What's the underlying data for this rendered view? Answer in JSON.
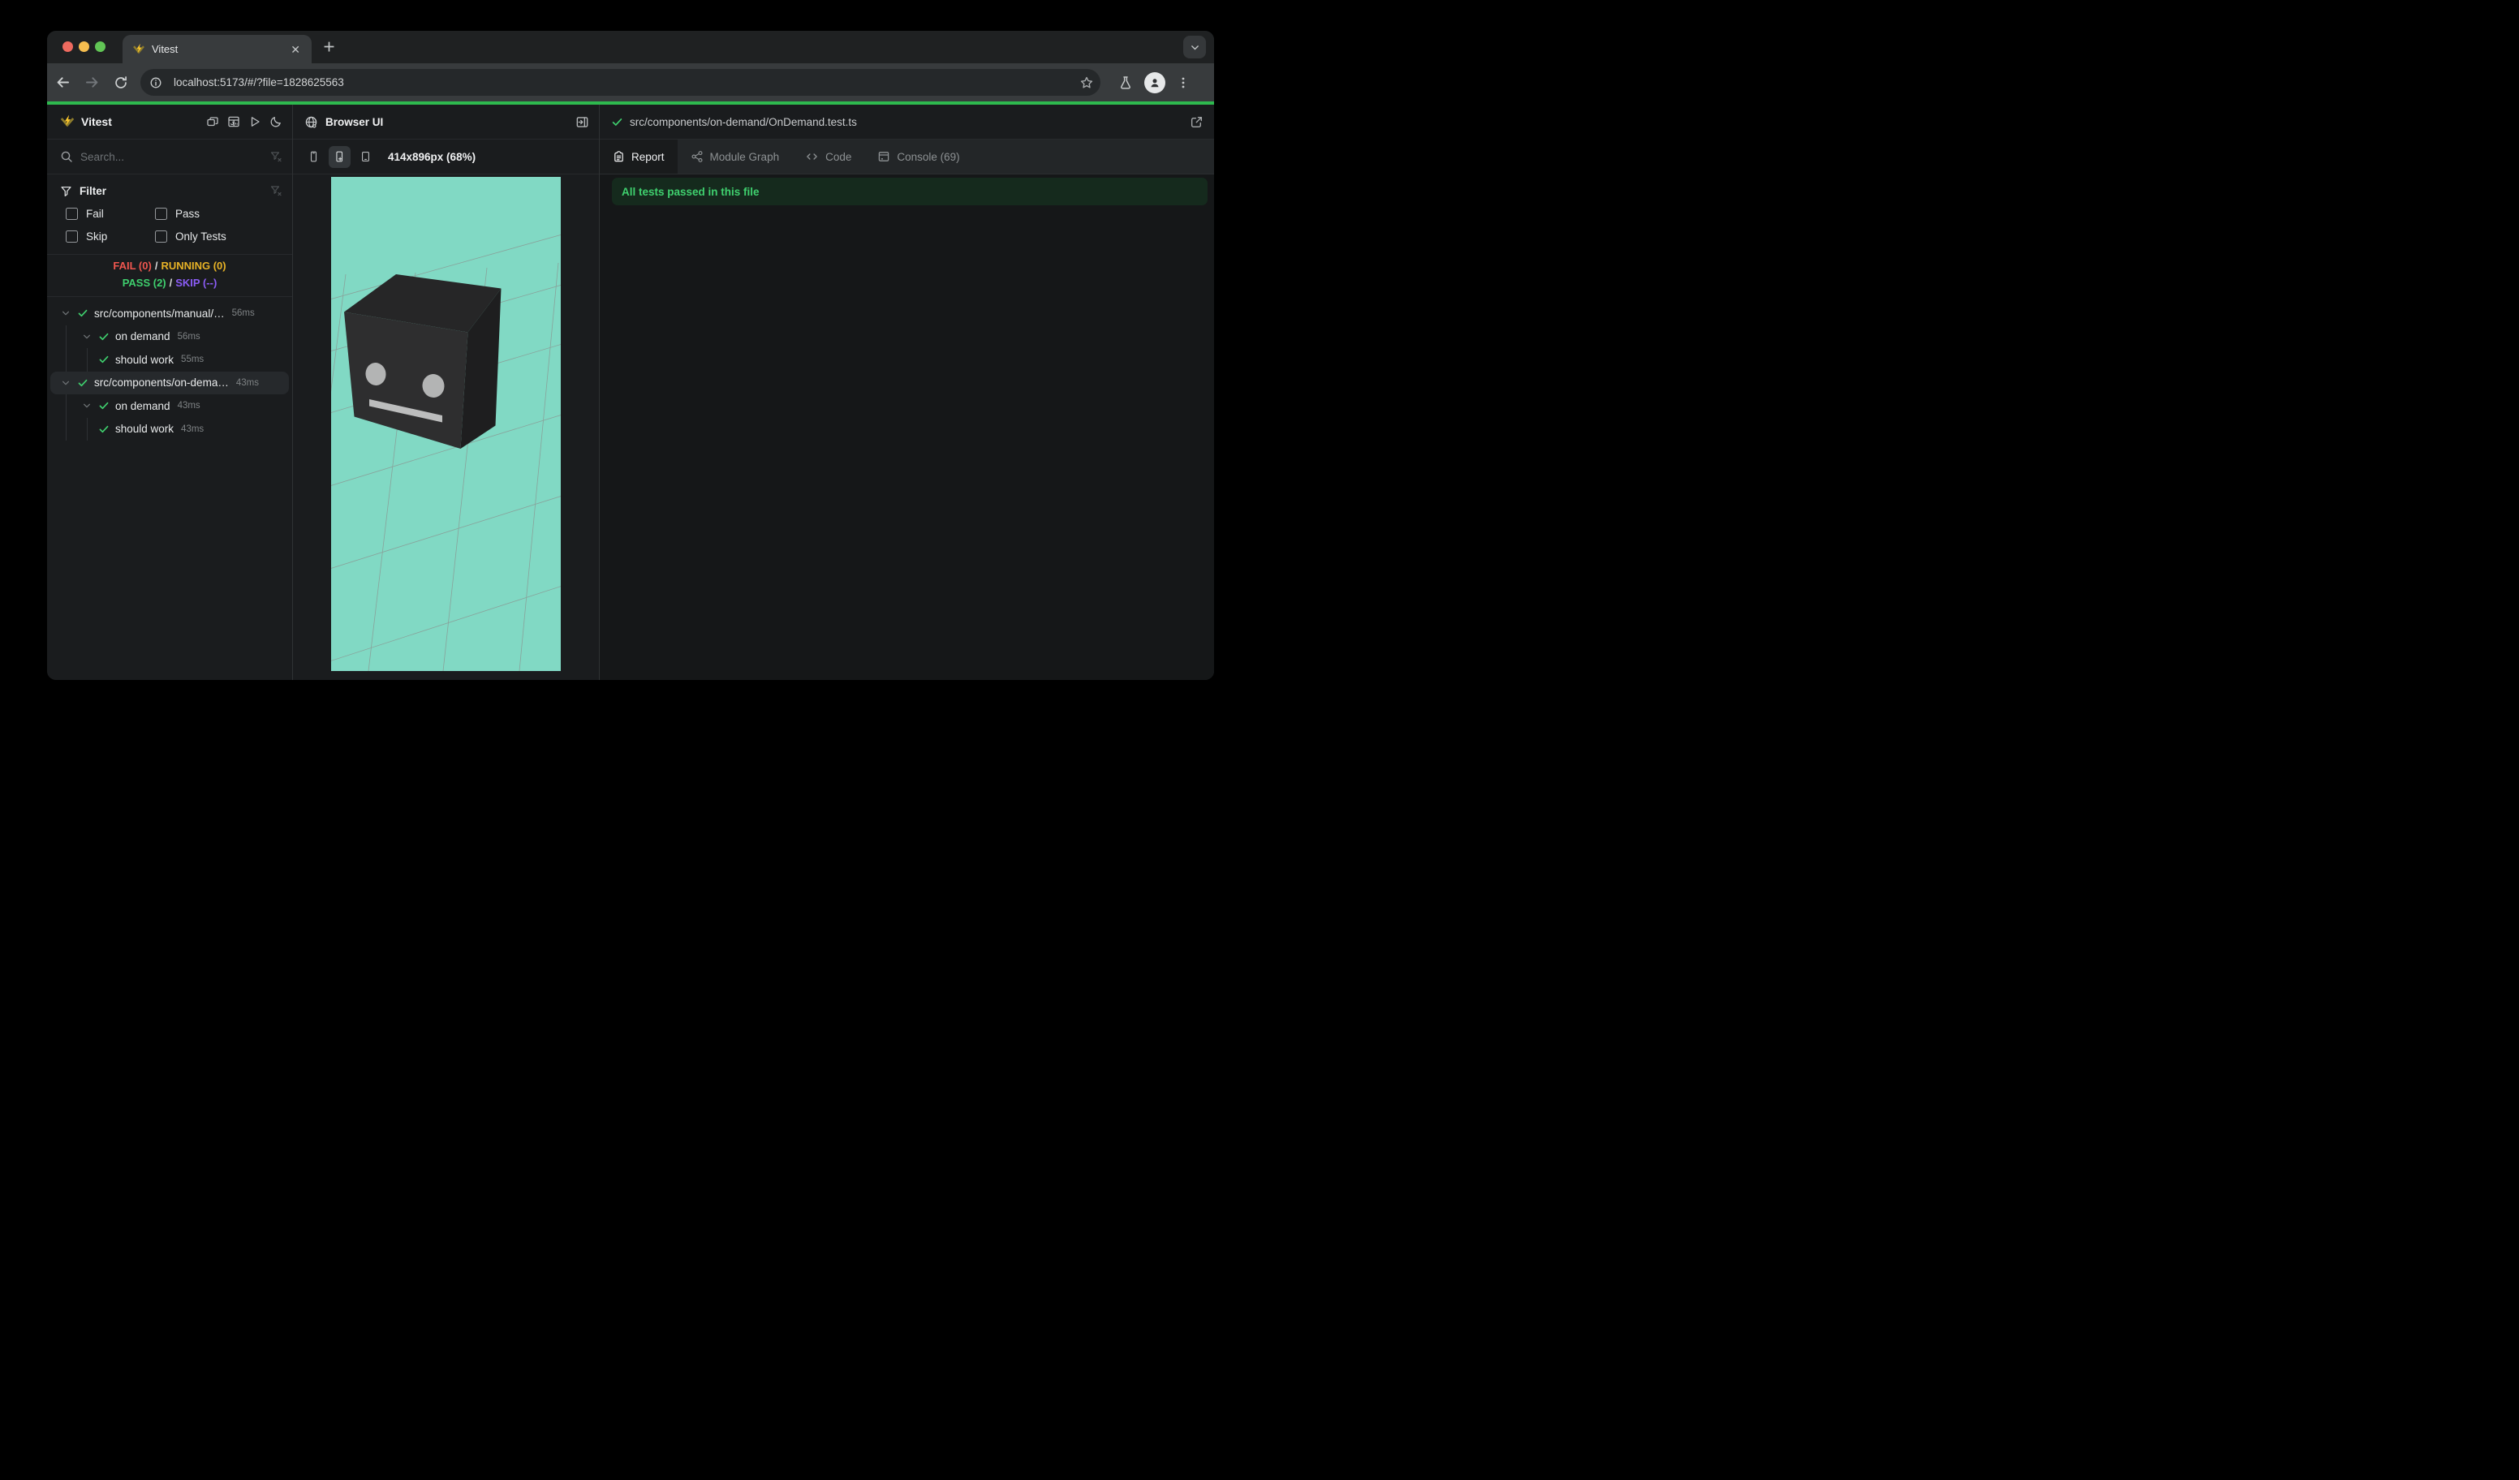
{
  "colors": {
    "accent_line": "#2eb94e",
    "pass_green": "#3fd06e",
    "fail_red": "#f0564f",
    "running_yellow": "#e7b226",
    "skip_purple": "#8b5cf6",
    "banner_bg": "#152a1d",
    "canvas_bg": "#81d9c4",
    "traffic_red": "#ee6a5f",
    "traffic_yellow": "#f5bd4f",
    "traffic_green": "#61c555"
  },
  "browser": {
    "tab_title": "Vitest",
    "url": "localhost:5173/#/?file=1828625563"
  },
  "sidebar": {
    "app_name": "Vitest",
    "search_placeholder": "Search...",
    "filter": {
      "title": "Filter",
      "options": [
        {
          "label": "Fail",
          "checked": false
        },
        {
          "label": "Pass",
          "checked": false
        },
        {
          "label": "Skip",
          "checked": false
        },
        {
          "label": "Only Tests",
          "checked": false
        }
      ]
    },
    "summary": {
      "fail_label": "FAIL (0)",
      "running_label": "RUNNING (0)",
      "pass_label": "PASS (2)",
      "skip_label": "SKIP (--)",
      "separator": "/"
    },
    "tree": [
      {
        "kind": "file",
        "label": "src/components/manual/…",
        "duration": "56ms",
        "selected": false
      },
      {
        "kind": "suite",
        "label": "on demand",
        "duration": "56ms",
        "selected": false
      },
      {
        "kind": "test",
        "label": "should work",
        "duration": "55ms",
        "selected": false
      },
      {
        "kind": "file",
        "label": "src/components/on-dema…",
        "duration": "43ms",
        "selected": true
      },
      {
        "kind": "suite",
        "label": "on demand",
        "duration": "43ms",
        "selected": false
      },
      {
        "kind": "test",
        "label": "should work",
        "duration": "43ms",
        "selected": false
      }
    ]
  },
  "preview": {
    "title": "Browser UI",
    "viewport_label": "414x896px (68%)"
  },
  "details": {
    "file_path": "src/components/on-demand/OnDemand.test.ts",
    "tabs": [
      {
        "label": "Report",
        "icon": "report-icon",
        "active": true
      },
      {
        "label": "Module Graph",
        "icon": "module-graph-icon",
        "active": false
      },
      {
        "label": "Code",
        "icon": "code-icon",
        "active": false
      },
      {
        "label": "Console (69)",
        "icon": "console-icon",
        "active": false
      }
    ],
    "banner_text": "All tests passed in this file"
  }
}
